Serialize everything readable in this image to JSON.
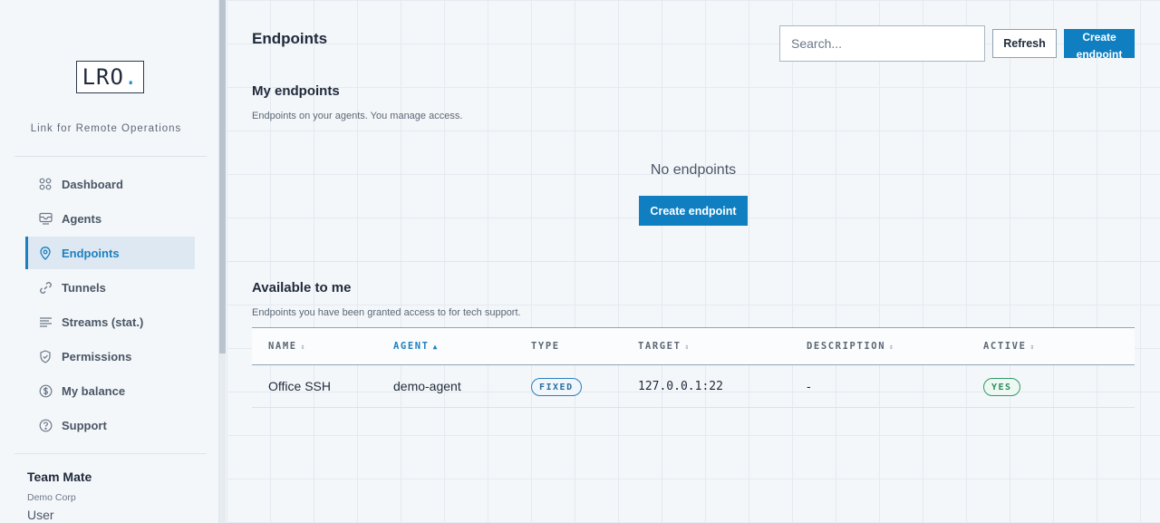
{
  "sidebar": {
    "logo": {
      "text": "LRO",
      "dot": "."
    },
    "tagline": "Link for Remote Operations",
    "items": [
      {
        "label": "Dashboard",
        "icon": "dashboard-icon"
      },
      {
        "label": "Agents",
        "icon": "agents-icon"
      },
      {
        "label": "Endpoints",
        "icon": "location-pin-icon",
        "active": true
      },
      {
        "label": "Tunnels",
        "icon": "link-icon"
      },
      {
        "label": "Streams (stat.)",
        "icon": "streams-icon"
      },
      {
        "label": "Permissions",
        "icon": "shield-icon"
      },
      {
        "label": "My balance",
        "icon": "dollar-icon"
      },
      {
        "label": "Support",
        "icon": "help-icon"
      }
    ],
    "user": {
      "name": "Team Mate",
      "org": "Demo Corp",
      "role": "User"
    }
  },
  "header": {
    "title": "Endpoints",
    "search_placeholder": "Search...",
    "refresh_label": "Refresh",
    "create_label": "Create endpoint"
  },
  "my_endpoints": {
    "title": "My endpoints",
    "subtitle": "Endpoints on your agents. You manage access.",
    "empty_text": "No endpoints",
    "create_label": "Create endpoint"
  },
  "available": {
    "title": "Available to me",
    "subtitle": "Endpoints you have been granted access to for tech support.",
    "columns": [
      "NAME",
      "AGENT",
      "TYPE",
      "TARGET",
      "DESCRIPTION",
      "ACTIVE"
    ],
    "sort_neutral": "⇕",
    "sort_asc": "▲",
    "rows": [
      {
        "name": "Office SSH",
        "agent": "demo-agent",
        "type": "FIXED",
        "target": "127.0.0.1:22",
        "description": "-",
        "active": "YES"
      }
    ]
  },
  "colors": {
    "accent": "#0f7fc2",
    "active_nav": "#1d7fbf",
    "badge_green": "#2e9a6a"
  }
}
